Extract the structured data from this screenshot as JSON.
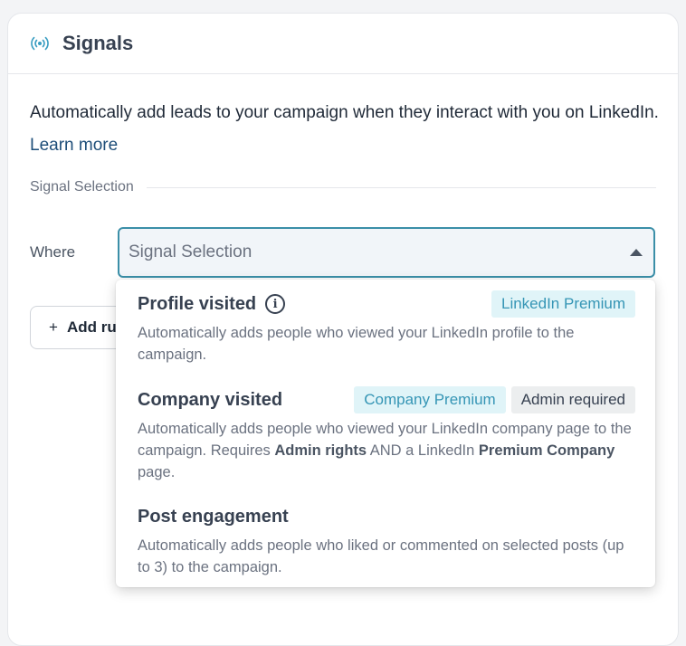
{
  "header": {
    "title": "Signals",
    "icon": "signal-broadcast-icon",
    "icon_color": "#3b9ec2"
  },
  "description": {
    "text": "Automatically add leads to your campaign when they interact with you on LinkedIn.",
    "learn_more": "Learn more"
  },
  "section": {
    "label": "Signal Selection"
  },
  "where": {
    "label": "Where",
    "select_placeholder": "Signal Selection"
  },
  "add_rule": {
    "label": "Add ru"
  },
  "dropdown": {
    "options": [
      {
        "title": "Profile visited",
        "badges": [
          "LinkedIn Premium"
        ],
        "description": "Automatically adds people who viewed your LinkedIn profile to the campaign."
      },
      {
        "title": "Company visited",
        "badges": [
          "Company Premium",
          "Admin required"
        ],
        "description_pre": "Automatically adds people who viewed your LinkedIn company page to the campaign. Requires ",
        "description_bold1": "Admin rights",
        "description_mid": " AND a LinkedIn ",
        "description_bold2": "Premium Company",
        "description_post": " page."
      },
      {
        "title": "Post engagement",
        "badges": [],
        "description": "Automatically adds people who liked or commented on selected posts (up to 3) to the campaign."
      }
    ]
  },
  "colors": {
    "accent": "#3b8fa8",
    "badge_premium_bg": "#e0f4f8",
    "badge_premium_text": "#3595b5",
    "badge_admin_bg": "#eceeef"
  }
}
